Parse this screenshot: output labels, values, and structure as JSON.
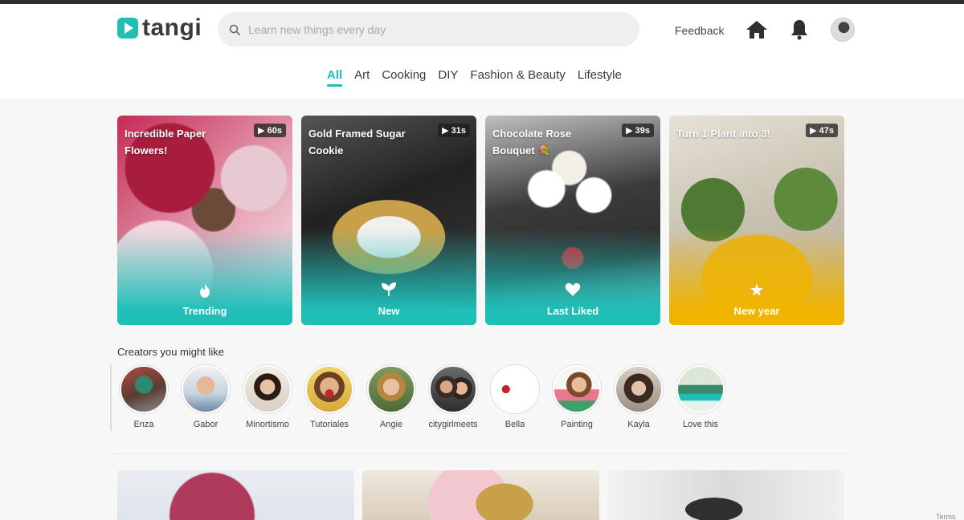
{
  "brand": {
    "name": "tangi"
  },
  "search": {
    "placeholder": "Learn new things every day"
  },
  "nav": {
    "feedback": "Feedback"
  },
  "categories": [
    {
      "label": "All",
      "active": true
    },
    {
      "label": "Art"
    },
    {
      "label": "Cooking"
    },
    {
      "label": "DIY"
    },
    {
      "label": "Fashion & Beauty"
    },
    {
      "label": "Lifestyle"
    }
  ],
  "cards": [
    {
      "title": "Incredible Paper Flowers!",
      "duration": "60s",
      "label": "Trending",
      "icon": "flame-icon",
      "color": "#1fbfb8"
    },
    {
      "title": "Gold Framed Sugar Cookie",
      "duration": "31s",
      "label": "New",
      "icon": "sprout-icon",
      "color": "#1fbfb8"
    },
    {
      "title": "Chocolate Rose Bouquet 💐",
      "duration": "39s",
      "label": "Last Liked",
      "icon": "heart-icon",
      "color": "#1fbfb8"
    },
    {
      "title": "Turn 1 Plant into 3!",
      "duration": "47s",
      "label": "New year",
      "icon": "star-icon",
      "color": "#f0b400"
    }
  ],
  "creators_section": {
    "title": "Creators you might like"
  },
  "creators": [
    {
      "name": "Enza"
    },
    {
      "name": "Gabor"
    },
    {
      "name": "Minortismo"
    },
    {
      "name": "Tutoriales"
    },
    {
      "name": "Angie"
    },
    {
      "name": "citygirlmeets"
    },
    {
      "name": "Bella"
    },
    {
      "name": "Painting"
    },
    {
      "name": "Kayla"
    },
    {
      "name": "Love this"
    }
  ],
  "footer": {
    "terms": "Terms"
  }
}
